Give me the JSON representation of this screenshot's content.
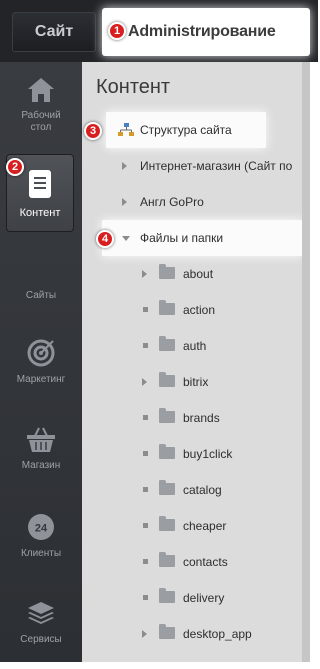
{
  "header": {
    "tab_site": "Сайт",
    "tab_admin": "Administrирование"
  },
  "markers": {
    "m1": "1",
    "m2": "2",
    "m3": "3",
    "m4": "4"
  },
  "sidebar": {
    "items": [
      {
        "label": "Рабочий стол",
        "icon": "home-icon"
      },
      {
        "label": "Контент",
        "icon": "document-icon"
      },
      {
        "label": "Сайты",
        "icon": "globe-icon"
      },
      {
        "label": "Маркетинг",
        "icon": "target-icon"
      },
      {
        "label": "Магазин",
        "icon": "basket-icon"
      },
      {
        "label": "Клиенты",
        "icon": "clients-24-icon"
      },
      {
        "label": "Сервисы",
        "icon": "layers-icon"
      }
    ]
  },
  "panel": {
    "title": "Контент",
    "tree": {
      "site_structure": "Структура сайта",
      "eshop": "Интернет-магазин (Сайт по",
      "angl": "Англ GoPro",
      "files": "Файлы и папки",
      "folders": [
        "about",
        "action",
        "auth",
        "bitrix",
        "brands",
        "buy1click",
        "catalog",
        "cheaper",
        "contacts",
        "delivery",
        "desktop_app"
      ]
    }
  },
  "colors": {
    "marker": "#d81f1f",
    "sidebar": "#34373b",
    "panel": "#dcdcdc",
    "topbar": "#222428"
  }
}
